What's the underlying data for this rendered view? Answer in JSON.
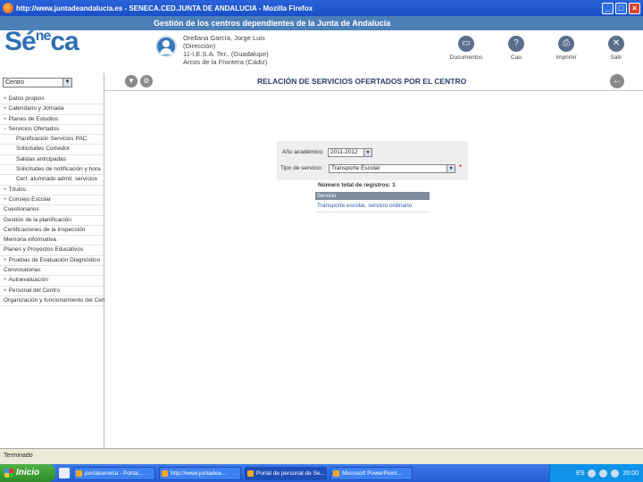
{
  "browser": {
    "title": "http://www.juntadeandalucia.es - SENECA.CED.JUNTA DE ANDALUCIA - Mozilla Firefox",
    "buttons": {
      "minimize": "_",
      "maximize": "□",
      "close": "×"
    }
  },
  "header": {
    "banner": "Gestión de los centros dependientes de la Junta de Andalucía",
    "logo_main": "Sé",
    "logo_sup": "ne",
    "logo_end": "ca",
    "user": {
      "line1": "Orellana García, Jorge Luis",
      "line2": "(Dirección)",
      "line3": "11-I.E.S.A. Ter.. (Guadalupe)",
      "line4": "Arcos de la Frontera (Cádiz)"
    },
    "actions": [
      {
        "label": "Documentos",
        "icon": "documents-icon"
      },
      {
        "label": "Cau",
        "icon": "help-icon"
      },
      {
        "label": "Imprimir",
        "icon": "print-icon"
      },
      {
        "label": "Salir",
        "icon": "exit-icon"
      }
    ]
  },
  "sidebar": {
    "centro_select": "Centro",
    "items": [
      {
        "label": "Datos propios",
        "exp": "+"
      },
      {
        "label": "Calendario y Jornada",
        "exp": "+"
      },
      {
        "label": "Planes de Estudios",
        "exp": "+"
      },
      {
        "label": "Servicios Ofertados",
        "exp": "−",
        "hl": true
      },
      {
        "label": "Planificación Servicios PAC",
        "sub": true
      },
      {
        "label": "Solicitudes Comedor",
        "sub": true
      },
      {
        "label": "Salidas anticipadas",
        "sub": true
      },
      {
        "label": "Solicitudes de notificación y hora",
        "sub": true
      },
      {
        "label": "Cert. alumnado admit. servicios",
        "sub": true
      },
      {
        "label": "Títulos",
        "exp": "+"
      },
      {
        "label": "Consejo Escolar",
        "exp": "+"
      },
      {
        "label": "Cuestionarios"
      },
      {
        "label": "Gestión de la planificación"
      },
      {
        "label": "Certificaciones de la Inspección"
      },
      {
        "label": "Memoria informativa"
      },
      {
        "label": "Planes y Proyectos Educativos"
      },
      {
        "label": "Pruebas de Evaluación Diagnóstico",
        "exp": "+"
      },
      {
        "label": "Convocatorias"
      },
      {
        "label": "Autoevaluación",
        "exp": "+"
      },
      {
        "label": "Personal del Centro",
        "exp": "+"
      },
      {
        "label": "Organización y funcionamiento del Centro"
      }
    ]
  },
  "main": {
    "heading": "RELACIÓN DE SERVICIOS OFERTADOS POR EL CENTRO",
    "filters": {
      "year_label": "Año académico:",
      "year_value": "2011-2012",
      "type_label": "Tipo de servicio:",
      "type_value": "Transporte Escolar",
      "required_mark": "*"
    },
    "total_label": "Número total de registros: 1",
    "table": {
      "header": "Servicio",
      "rows": [
        "Transporte escolar, servicio ordinario"
      ]
    }
  },
  "statusbar": {
    "text": "Terminado"
  },
  "taskbar": {
    "start": "Inicio",
    "tasks": [
      "portalseneca - Portal...",
      "http://www.juntadea...",
      "Portal de personal de Se...",
      "Microsoft PowerPoint..."
    ],
    "tray_lang": "ES",
    "clock": "20:00"
  }
}
